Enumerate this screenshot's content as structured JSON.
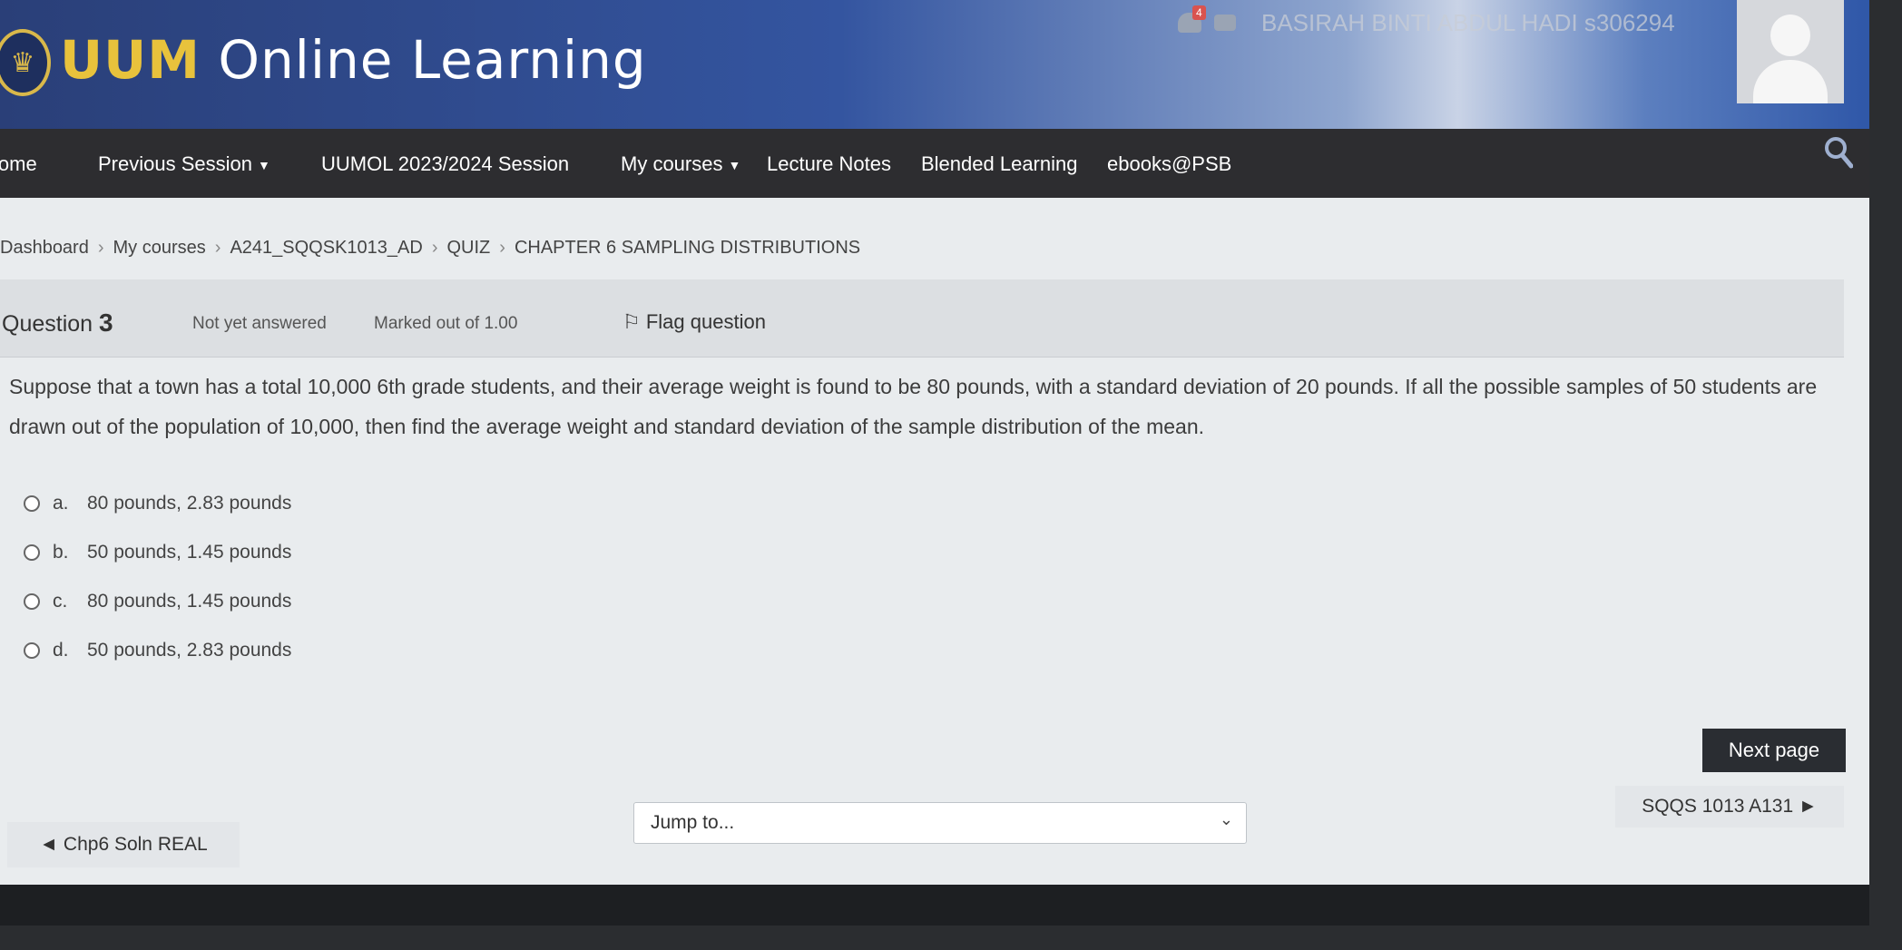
{
  "header": {
    "logo_brand": "UUM",
    "logo_rest": " Online Learning",
    "notification_count": "4",
    "user_name": "BASIRAH BINTI ABDUL HADI s306294"
  },
  "nav": {
    "items": [
      "Home",
      "Previous Session",
      "UUMOL 2023/2024 Session",
      "My courses",
      "Lecture Notes",
      "Blended Learning",
      "ebooks@PSB"
    ]
  },
  "breadcrumb": [
    "Dashboard",
    "My courses",
    "A241_SQQSK1013_AD",
    "QUIZ",
    "CHAPTER 6 SAMPLING DISTRIBUTIONS"
  ],
  "question": {
    "label": "Question",
    "number": "3",
    "status": "Not yet answered",
    "marks": "Marked out of 1.00",
    "flag_label": "Flag question",
    "text": "Suppose that a town has a total 10,000 6th grade students, and their average weight is found to be 80 pounds, with a standard deviation of 20 pounds. If all the possible samples of 50 students are drawn out of the population of 10,000, then find the average weight and standard deviation of the sample distribution of the mean.",
    "answers": [
      {
        "letter": "a.",
        "text": "80 pounds, 2.83 pounds"
      },
      {
        "letter": "b.",
        "text": "50 pounds, 1.45 pounds"
      },
      {
        "letter": "c.",
        "text": "80 pounds, 1.45 pounds"
      },
      {
        "letter": "d.",
        "text": "50 pounds, 2.83 pounds"
      }
    ]
  },
  "navigation": {
    "next_page": "Next page",
    "next_course": "SQQS 1013 A131 ►",
    "prev_course": "◄ Chp6 Soln REAL",
    "jump_placeholder": "Jump to..."
  }
}
